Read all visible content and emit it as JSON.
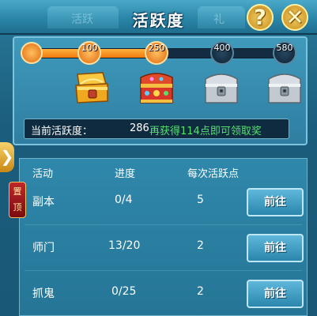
{
  "header": {
    "title": "活跃度",
    "background_tabs": [
      "活跃",
      "礼"
    ],
    "help_label": "?",
    "close_label": "✕"
  },
  "progress": {
    "current": 286,
    "max": 580,
    "fill_fraction": 0.52,
    "milestones": [
      "100",
      "250",
      "400",
      "580"
    ],
    "milestones_reached": [
      true,
      true,
      false,
      false
    ],
    "chests": [
      {
        "icon": "chest-open-gold-icon",
        "state": "opened"
      },
      {
        "icon": "chest-red-jeweled-icon",
        "state": "available"
      },
      {
        "icon": "chest-silver-locked-icon",
        "state": "locked"
      },
      {
        "icon": "chest-silver-locked-icon",
        "state": "locked"
      }
    ]
  },
  "status": {
    "label": "当前活跃度：",
    "value": "286",
    "tip": "再获得114点即可领取奖"
  },
  "side": {
    "arrow_label": "❯",
    "pin_label": "置顶"
  },
  "table": {
    "headers": [
      "活动",
      "进度",
      "每次活跃点"
    ],
    "rows": [
      {
        "name": "副本",
        "progress": "0/4",
        "points": "5",
        "button": "前往"
      },
      {
        "name": "师门",
        "progress": "13/20",
        "points": "2",
        "button": "前往"
      },
      {
        "name": "抓鬼",
        "progress": "0/25",
        "points": "2",
        "button": "前往"
      }
    ]
  },
  "colors": {
    "accent_orange": "#f07a10",
    "tip_green": "#53e36b",
    "panel_blue": "#2f7ea1"
  }
}
